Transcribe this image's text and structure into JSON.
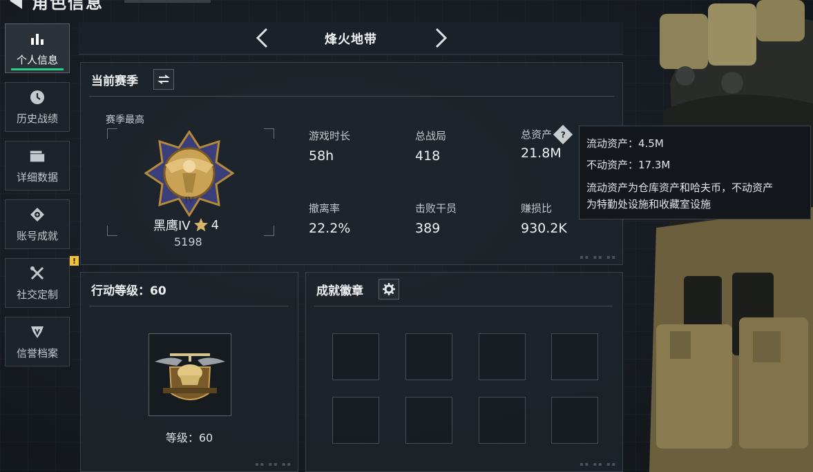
{
  "header": {
    "title": "角色信息"
  },
  "sidebar": {
    "items": [
      {
        "label": "个人信息",
        "icon": "bar-chart-icon",
        "active": true
      },
      {
        "label": "历史战绩",
        "icon": "clock-icon",
        "active": false
      },
      {
        "label": "详细数据",
        "icon": "folder-icon",
        "active": false
      },
      {
        "label": "账号成就",
        "icon": "medal-icon",
        "active": false
      },
      {
        "label": "社交定制",
        "icon": "tools-icon",
        "active": false,
        "badge": "!"
      },
      {
        "label": "信誉档案",
        "icon": "shield-icon",
        "active": false
      }
    ]
  },
  "mode_selector": {
    "title": "烽火地带"
  },
  "season_panel": {
    "title": "当前赛季",
    "best_label": "赛季最高",
    "rank_name": "黑鹰IV",
    "rank_stars": "4",
    "rank_score": "5198",
    "stats": [
      {
        "label": "游戏时长",
        "value": "58h"
      },
      {
        "label": "总战局",
        "value": "418"
      },
      {
        "label": "总资产",
        "value": "21.8M",
        "help": true
      },
      {
        "label": "撤离率",
        "value": "22.2%"
      },
      {
        "label": "击败干员",
        "value": "389"
      },
      {
        "label": "赚损比",
        "value": "930.2K"
      }
    ]
  },
  "tooltip": {
    "liquid": "流动资产：4.5M",
    "fixed": "不动资产：17.3M",
    "desc_line1": "流动资产为仓库资产和哈夫币，不动资产",
    "desc_line2": "为特勤处设施和收藏室设施"
  },
  "level_panel": {
    "title": "行动等级：60",
    "level_label": "等级：60"
  },
  "badge_panel": {
    "title": "成就徽章",
    "slot_count": 8
  },
  "colors": {
    "accent": "#2ad08a",
    "warning": "#f2c230",
    "panel_bg": "#1e242b"
  }
}
